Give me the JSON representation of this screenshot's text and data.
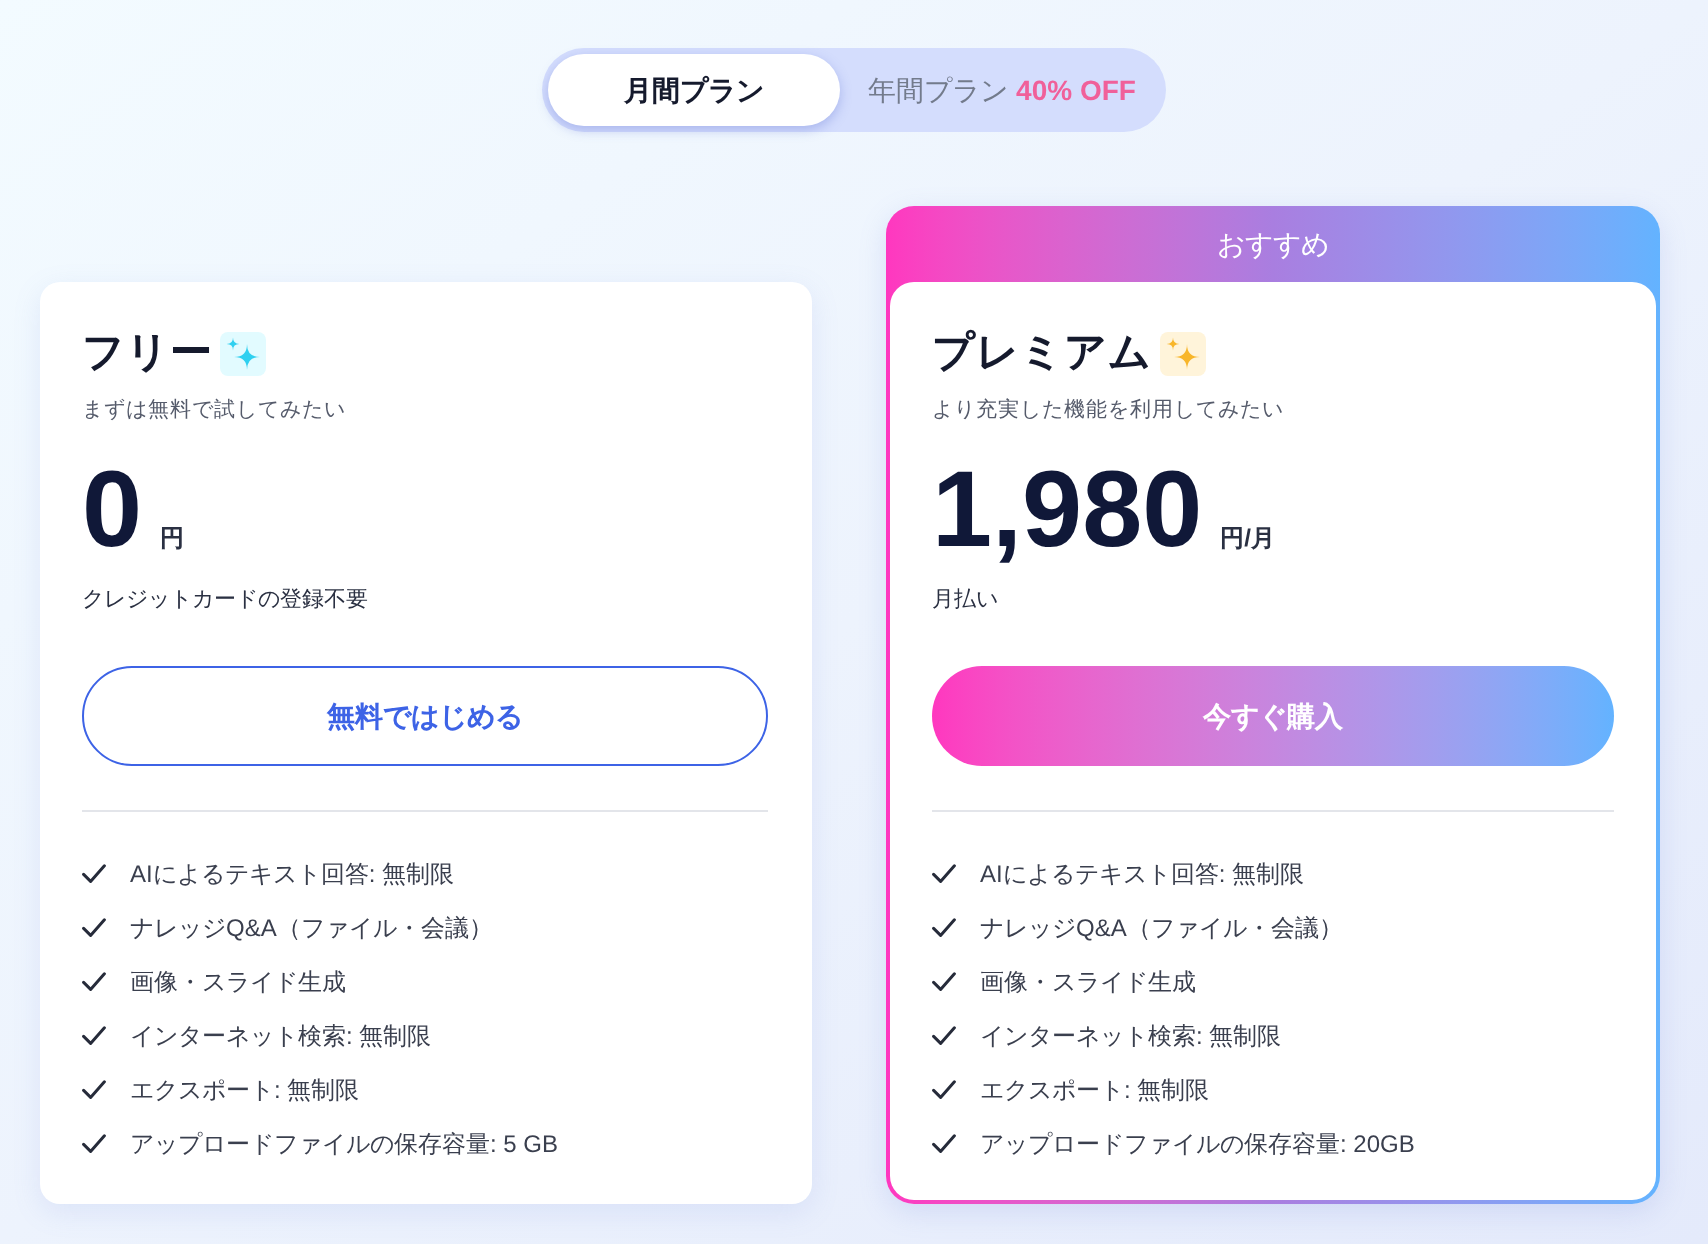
{
  "billing_toggle": {
    "tabs": [
      {
        "label": "月間プラン",
        "selected": true
      },
      {
        "label": "年間プラン",
        "selected": false,
        "badge": "40% OFF"
      }
    ]
  },
  "plans": [
    {
      "kind": "free",
      "name": "フリー",
      "tagline": "まずは無料で試してみたい",
      "price": "0",
      "unit": "円",
      "note": "クレジットカードの登録不要",
      "button": "無料ではじめる",
      "features": [
        "AIによるテキスト回答: 無制限",
        "ナレッジQ&A（ファイル・会議）",
        "画像・スライド生成",
        "インターネット検索: 無制限",
        "エクスポート: 無制限",
        "アップロードファイルの保存容量: 5 GB"
      ]
    },
    {
      "kind": "premium",
      "badge": "おすすめ",
      "name": "プレミアム",
      "tagline": "より充実した機能を利用してみたい",
      "price": "1,980",
      "unit": "円/月",
      "note": "月払い",
      "button": "今すぐ購入",
      "features": [
        "AIによるテキスト回答: 無制限",
        "ナレッジQ&A（ファイル・会議）",
        "画像・スライド生成",
        "インターネット検索: 無制限",
        "エクスポート: 無制限",
        "アップロードファイルの保存容量: 20GB"
      ]
    }
  ]
}
